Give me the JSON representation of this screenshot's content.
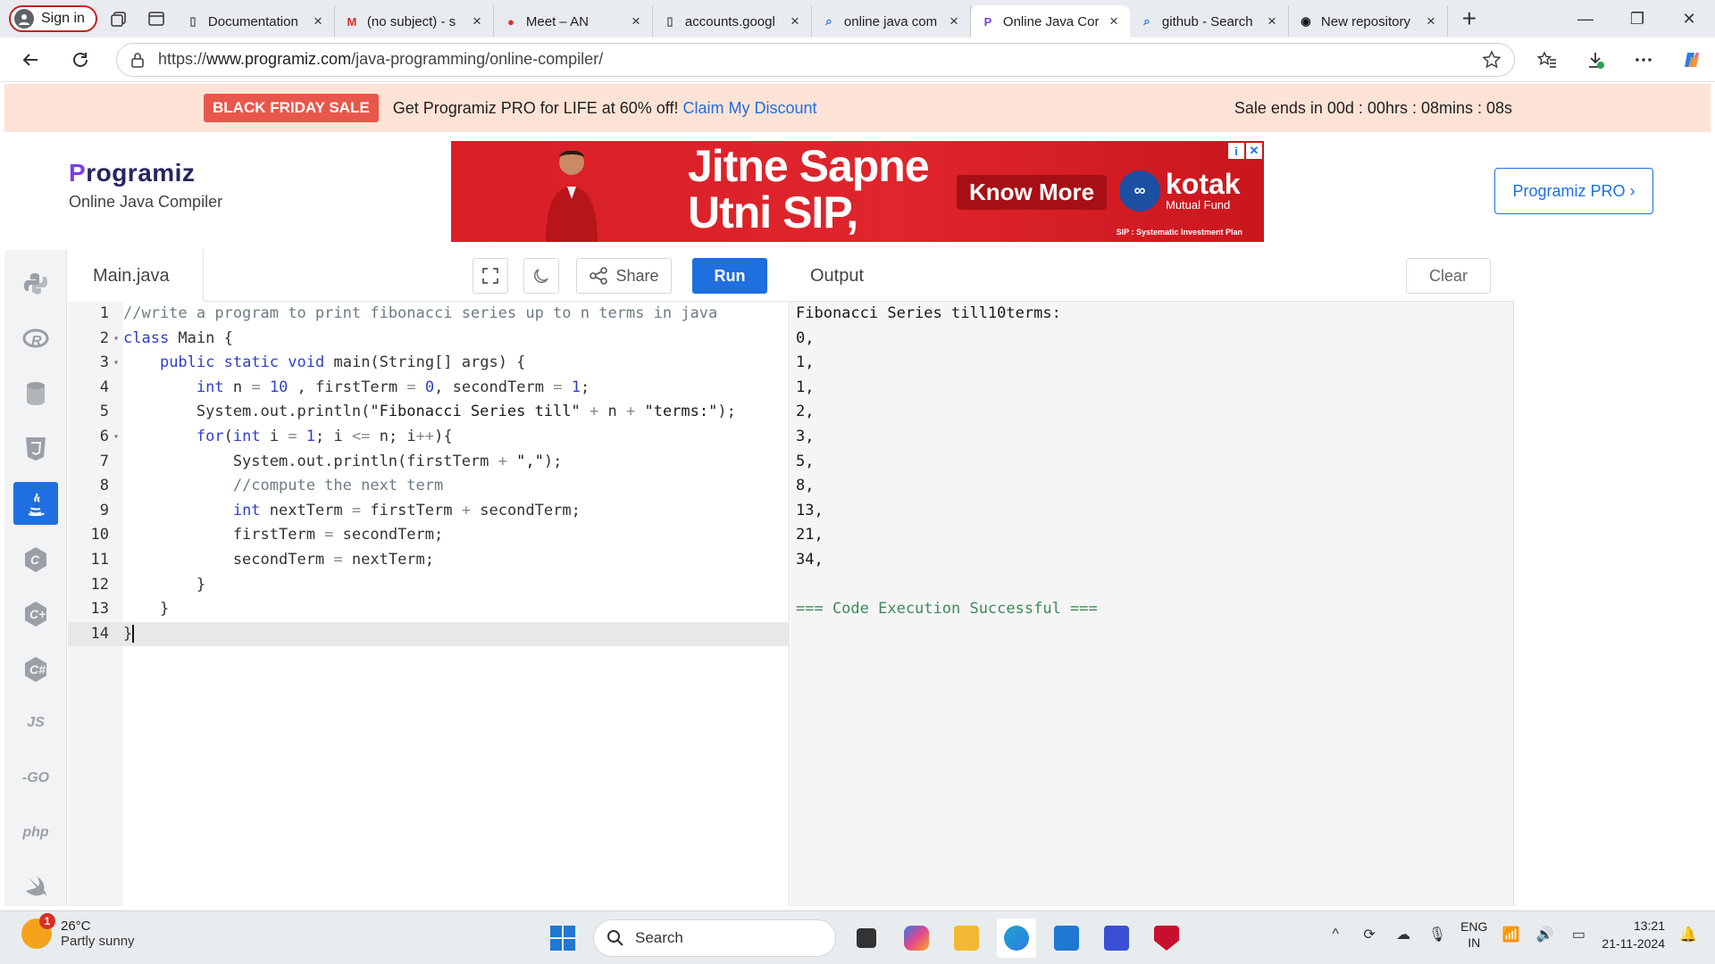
{
  "browser": {
    "profile_label": "Sign in",
    "tabs": [
      {
        "title": "Documentation",
        "favicon": "document-icon"
      },
      {
        "title": "(no subject) - s",
        "favicon": "gmail-icon"
      },
      {
        "title": "Meet – AN",
        "favicon": "meet-icon"
      },
      {
        "title": "accounts.googl",
        "favicon": "page-icon"
      },
      {
        "title": "online java com",
        "favicon": "search-icon"
      },
      {
        "title": "Online Java Cor",
        "favicon": "programiz-icon",
        "active": true
      },
      {
        "title": "github - Search",
        "favicon": "search-icon"
      },
      {
        "title": "New repository",
        "favicon": "github-icon"
      }
    ],
    "url_prefix": "https://",
    "url_domain": "www.programiz.com",
    "url_path": "/java-programming/online-compiler/"
  },
  "promo": {
    "badge": "BLACK FRIDAY SALE",
    "message": "Get Programiz PRO for LIFE at 60% off! ",
    "link": "Claim My Discount",
    "timer": "Sale ends in 00d : 00hrs : 08mins : 08s"
  },
  "header": {
    "logo_text": "rogramiz",
    "logo_initial": "P",
    "subtitle": "Online Java Compiler",
    "pro_button": "Programiz PRO ›"
  },
  "ad": {
    "headline_1": "Jitne Sapne",
    "headline_2": "Utni SIP,",
    "cta": "Know More",
    "brand": "kotak",
    "brand_sub": "Mutual Fund",
    "footnote": "SIP : Systematic Investment Plan"
  },
  "languages": [
    {
      "name": "python",
      "icon": "python-icon"
    },
    {
      "name": "r",
      "icon": "r-icon"
    },
    {
      "name": "sql",
      "icon": "database-icon"
    },
    {
      "name": "html",
      "icon": "html5-icon"
    },
    {
      "name": "java",
      "icon": "java-icon",
      "active": true
    },
    {
      "name": "c",
      "icon": "c-icon"
    },
    {
      "name": "cpp",
      "icon": "cpp-icon"
    },
    {
      "name": "csharp",
      "icon": "csharp-icon"
    },
    {
      "name": "js",
      "icon": "js-icon",
      "label": "JS"
    },
    {
      "name": "go",
      "icon": "go-icon",
      "label": "-GO"
    },
    {
      "name": "php",
      "icon": "php-icon",
      "label": "php"
    },
    {
      "name": "swift",
      "icon": "swift-icon"
    }
  ],
  "editor": {
    "file_name": "Main.java",
    "share_label": "Share",
    "run_label": "Run",
    "lines": [
      "//write a program to print fibonacci series up to n terms in java",
      "class Main {",
      "    public static void main(String[] args) {",
      "        int n = 10 , firstTerm = 0, secondTerm = 1;",
      "        System.out.println(\"Fibonacci Series till\" + n + \"terms:\");",
      "        for(int i = 1; i <= n; i++){",
      "            System.out.println(firstTerm + \",\");",
      "            //compute the next term",
      "            int nextTerm = firstTerm + secondTerm;",
      "            firstTerm = secondTerm;",
      "            secondTerm = nextTerm;",
      "        }",
      "    }",
      "}"
    ],
    "fold_lines": [
      2,
      3,
      6
    ],
    "active_line": 14
  },
  "output": {
    "title": "Output",
    "clear_label": "Clear",
    "lines": [
      "Fibonacci Series till10terms:",
      "0,",
      "1,",
      "1,",
      "2,",
      "3,",
      "5,",
      "8,",
      "13,",
      "21,",
      "34,",
      "",
      "=== Code Execution Successful ==="
    ]
  },
  "taskbar": {
    "weather_temp": "26°C",
    "weather_cond": "Partly sunny",
    "weather_badge": "1",
    "search_label": "Search",
    "lang_1": "ENG",
    "lang_2": "IN",
    "time": "13:21",
    "date": "21-11-2024"
  },
  "colors": {
    "accent": "#1f6fe0",
    "promo_bg": "#fde3d6",
    "badge": "#e8574b",
    "ad_red": "#d81f26"
  }
}
